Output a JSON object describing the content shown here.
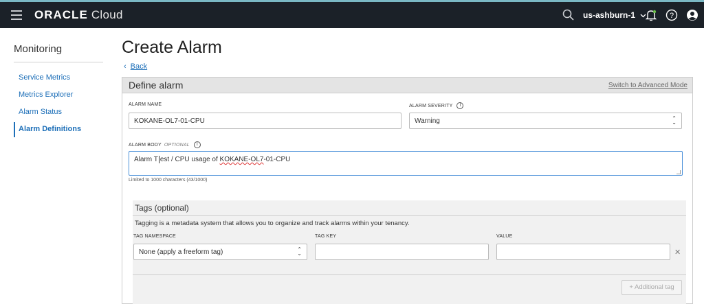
{
  "topbar": {
    "brand_oracle": "ORACLE",
    "brand_cloud": "Cloud",
    "region": "us-ashburn-1"
  },
  "sidebar": {
    "title": "Monitoring",
    "items": [
      {
        "label": "Service Metrics"
      },
      {
        "label": "Metrics Explorer"
      },
      {
        "label": "Alarm Status"
      },
      {
        "label": "Alarm Definitions"
      }
    ]
  },
  "page": {
    "title": "Create Alarm",
    "back_label": "Back"
  },
  "define": {
    "title": "Define alarm",
    "advanced_link": "Switch to Advanced Mode",
    "alarm_name_label": "ALARM NAME",
    "alarm_name_value": "KOKANE-OL7-01-CPU",
    "severity_label": "ALARM SEVERITY",
    "severity_value": "Warning",
    "body_label": "ALARM BODY",
    "body_optional": "OPTIONAL",
    "body_value_pre": "Alarm T",
    "body_value_mid": "est / CPU usage of ",
    "body_value_err": "KOKANE-OL7",
    "body_value_post": "-01-CPU",
    "body_hint": "Limited to 1000 characters (43/1000)"
  },
  "tags": {
    "title": "Tags (optional)",
    "description": "Tagging is a metadata system that allows you to organize and track alarms within your tenancy.",
    "namespace_label": "TAG NAMESPACE",
    "namespace_value": "None (apply a freeform tag)",
    "key_label": "TAG KEY",
    "key_value": "",
    "value_label": "VALUE",
    "value_value": "",
    "add_label": "+ Additional tag"
  },
  "colors": {
    "topbar_bg": "#1b2128",
    "link": "#1d6fb8",
    "accent_strip": "#7ab8c4"
  }
}
